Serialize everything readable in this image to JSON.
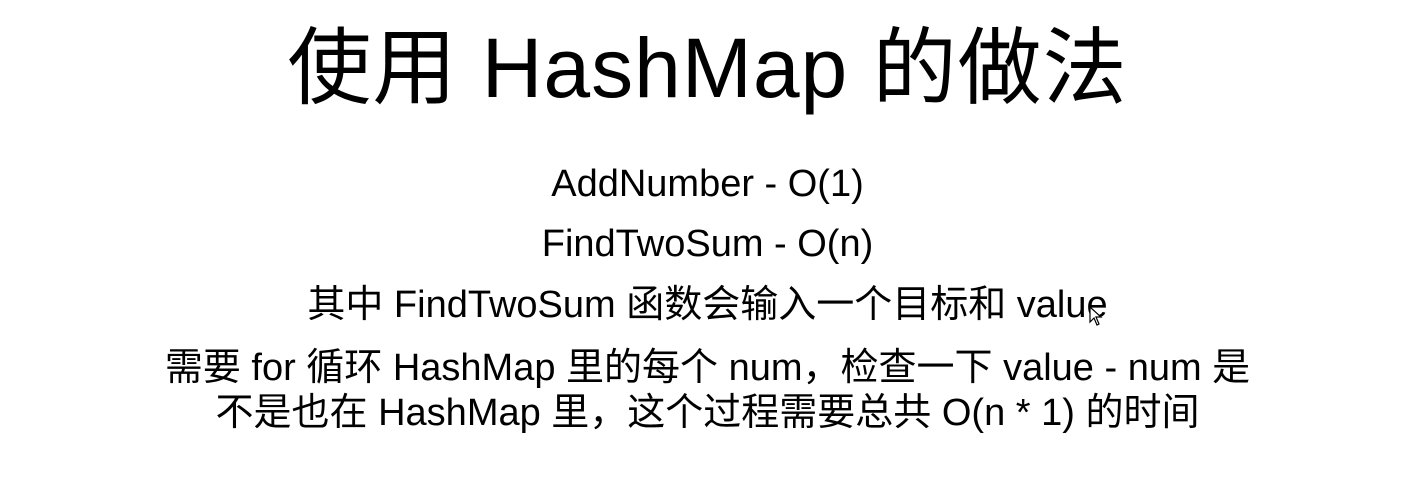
{
  "slide": {
    "title": "使用 HashMap 的做法",
    "lines": [
      "AddNumber - O(1)",
      "FindTwoSum - O(n)",
      "其中 FindTwoSum 函数会输入一个目标和 value",
      "需要 for 循环 HashMap 里的每个 num，检查一下 value - num 是",
      "不是也在 HashMap 里，这个过程需要总共 O(n * 1) 的时间"
    ]
  },
  "icons": {
    "cursor": "mouse-pointer-icon"
  }
}
